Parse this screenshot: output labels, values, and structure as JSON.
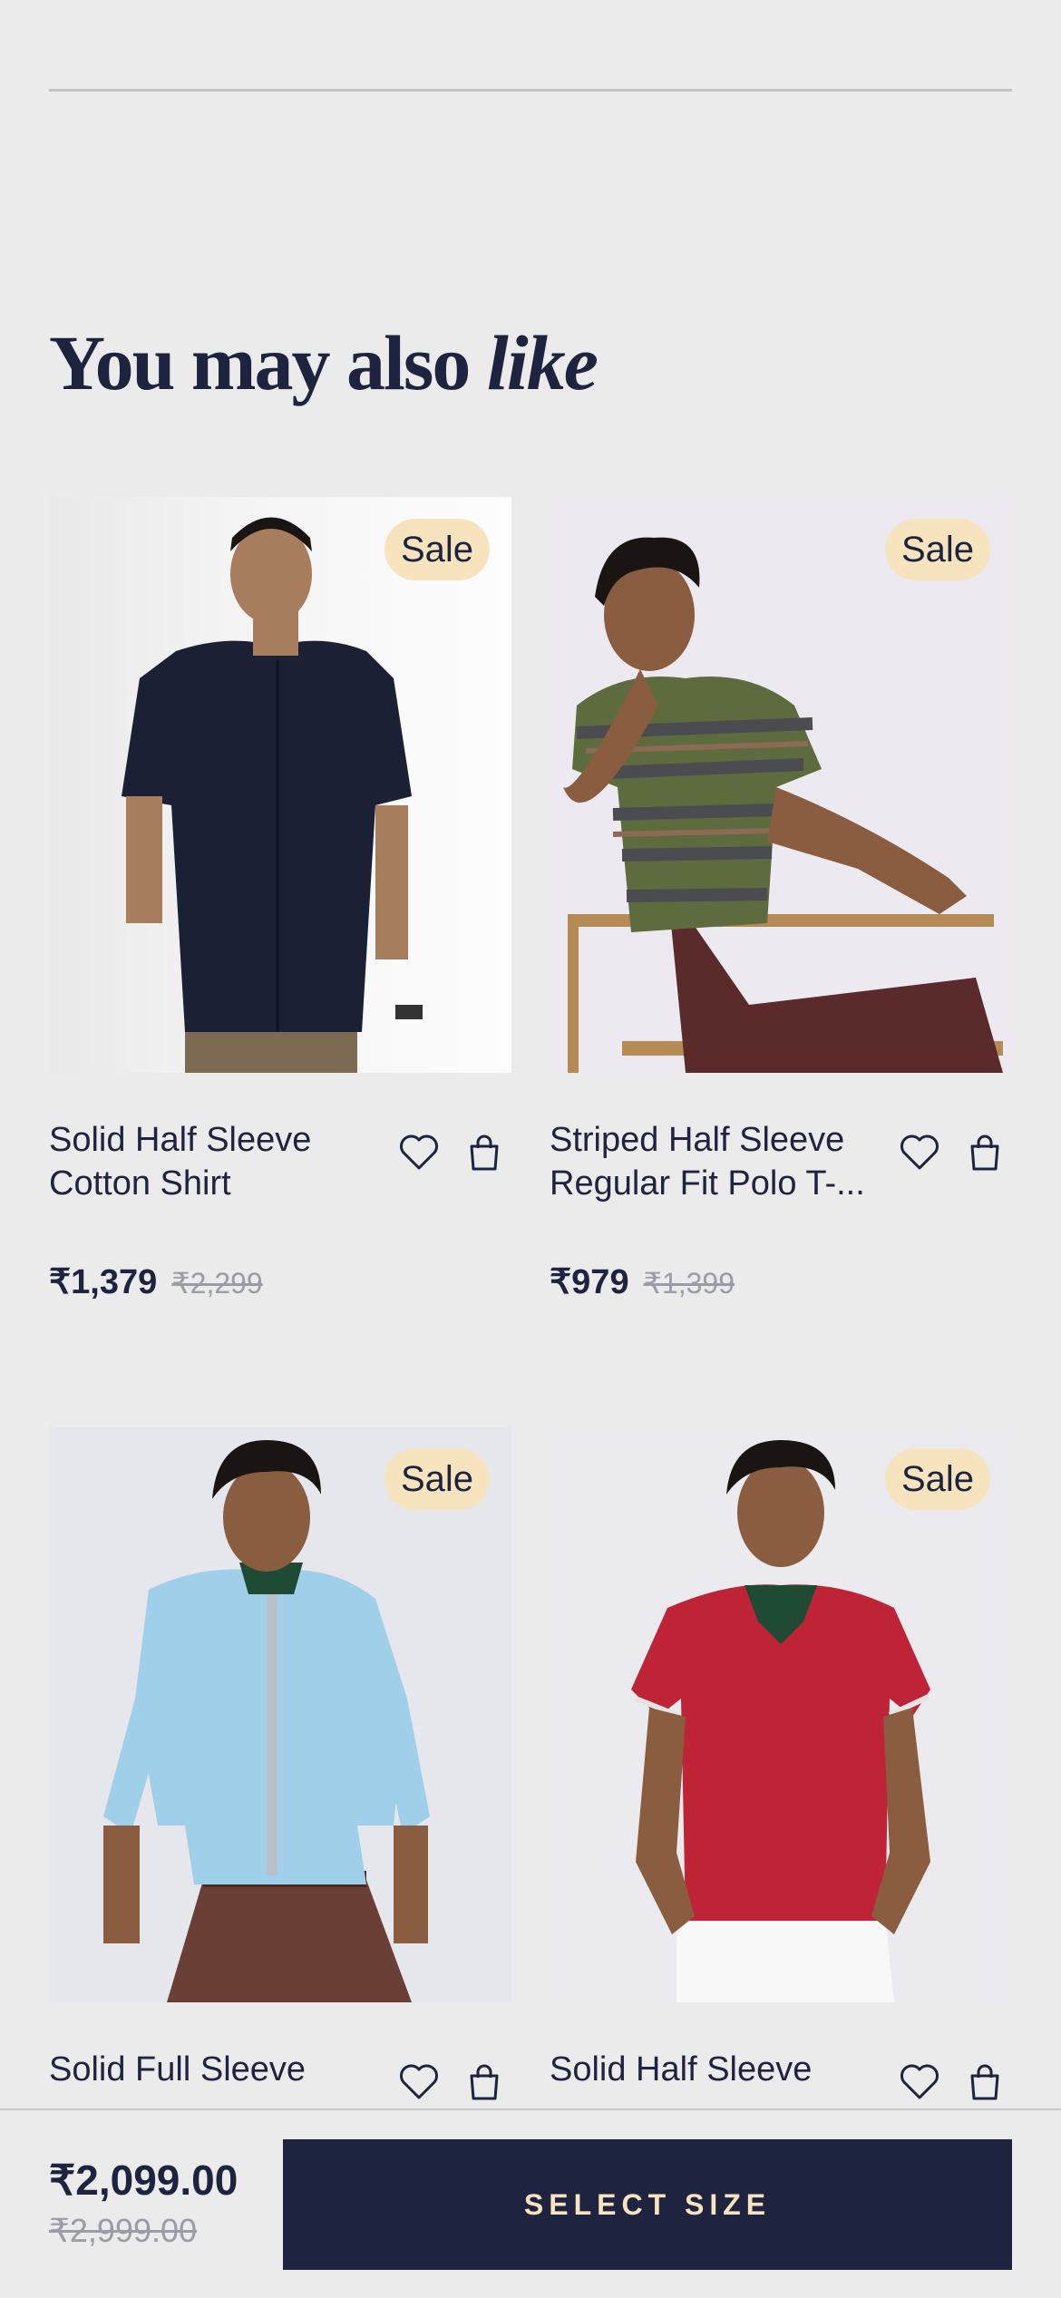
{
  "section": {
    "title_regular": "You may also",
    "title_italic": "like"
  },
  "products": [
    {
      "badge": "Sale",
      "title_line1": "Solid Half Sleeve",
      "title_line2": "Cotton Shirt",
      "price": "₹1,379",
      "mrp": "₹2,299",
      "image": "navy-half-sleeve-shirt-photo"
    },
    {
      "badge": "Sale",
      "title_line1": "Striped Half Sleeve",
      "title_line2": "Regular Fit Polo T-...",
      "price": "₹979",
      "mrp": "₹1,399",
      "image": "striped-polo-photo"
    },
    {
      "badge": "Sale",
      "title_line1": "Solid Full Sleeve",
      "title_line2": "",
      "price": "",
      "mrp": "",
      "image": "light-blue-full-sleeve-shirt-photo"
    },
    {
      "badge": "Sale",
      "title_line1": "Solid Half Sleeve",
      "title_line2": "",
      "price": "",
      "mrp": "",
      "image": "red-polo-photo"
    }
  ],
  "bottom_bar": {
    "price": "₹2,099.00",
    "mrp": "₹2,999.00",
    "cta_label": "SELECT SIZE"
  },
  "colors": {
    "background": "#ebebeb",
    "navy": "#1e2340",
    "badge": "#f7e3bd",
    "muted": "#9a9ca6"
  },
  "icons": [
    "heart-icon",
    "shopping-bag-icon"
  ]
}
